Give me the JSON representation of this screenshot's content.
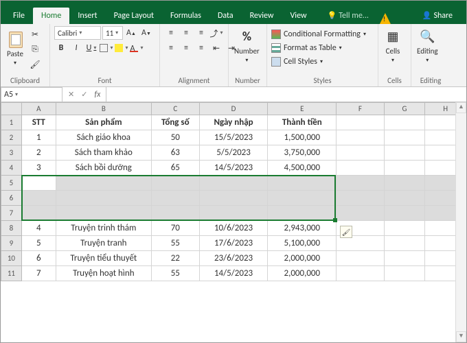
{
  "tabs": {
    "file": "File",
    "home": "Home",
    "insert": "Insert",
    "page_layout": "Page Layout",
    "formulas": "Formulas",
    "data": "Data",
    "review": "Review",
    "view": "View",
    "tell": "Tell me...",
    "share": "Share"
  },
  "ribbon": {
    "clipboard": {
      "label": "Clipboard",
      "paste": "Paste"
    },
    "font": {
      "label": "Font",
      "name": "Calibri",
      "size": "11"
    },
    "alignment": {
      "label": "Alignment"
    },
    "number": {
      "label": "Number",
      "btn": "Number"
    },
    "styles": {
      "label": "Styles",
      "cond": "Conditional Formatting",
      "table": "Format as Table",
      "cell": "Cell Styles"
    },
    "cells": {
      "label": "Cells",
      "btn": "Cells"
    },
    "editing": {
      "label": "Editing",
      "btn": "Editing"
    }
  },
  "namebox": "A5",
  "columns": [
    "A",
    "B",
    "C",
    "D",
    "E",
    "F",
    "G",
    "H"
  ],
  "headers": {
    "stt": "STT",
    "sp": "Sản phẩm",
    "ts": "Tổng số",
    "nn": "Ngày nhập",
    "tt": "Thành tiền"
  },
  "rows": [
    {
      "n": "1",
      "stt": "1",
      "sp": "Sách giáo khoa",
      "ts": "50",
      "nn": "15/5/2023",
      "tt": "1,500,000"
    },
    {
      "n": "2",
      "stt": "2",
      "sp": "Sách tham khảo",
      "ts": "63",
      "nn": "5/5/2023",
      "tt": "3,750,000"
    },
    {
      "n": "3",
      "stt": "3",
      "sp": "Sách bồi dưỡng",
      "ts": "65",
      "nn": "14/5/2023",
      "tt": "4,500,000"
    },
    {
      "n": "4",
      "blank": true,
      "active": true
    },
    {
      "n": "5",
      "blank": true
    },
    {
      "n": "6",
      "blank": true
    },
    {
      "n": "7",
      "stt": "4",
      "sp": "Truyện trinh thám",
      "ts": "70",
      "nn": "10/6/2023",
      "tt": "2,943,000"
    },
    {
      "n": "8",
      "stt": "5",
      "sp": "Truyện tranh",
      "ts": "55",
      "nn": "17/6/2023",
      "tt": "5,100,000"
    },
    {
      "n": "9",
      "stt": "6",
      "sp": "Truyện tiểu thuyết",
      "ts": "22",
      "nn": "23/6/2023",
      "tt": "2,000,000"
    },
    {
      "n": "10",
      "stt": "7",
      "sp": "Truyện hoạt hình",
      "ts": "55",
      "nn": "14/5/2023",
      "tt": "2,000,000"
    }
  ],
  "rowheads": [
    "1",
    "2",
    "3",
    "4",
    "5",
    "6",
    "7",
    "8",
    "9",
    "10",
    "11"
  ]
}
